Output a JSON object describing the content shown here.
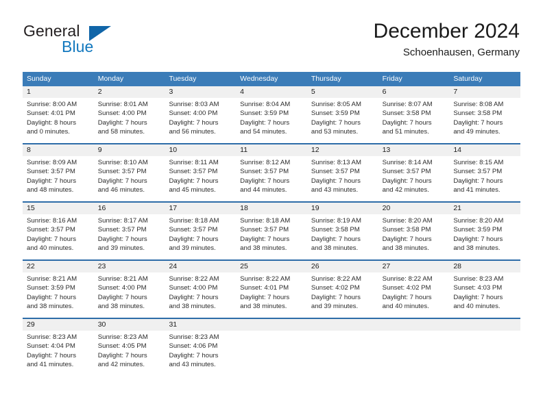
{
  "brand": {
    "name_part1": "General",
    "name_part2": "Blue",
    "accent_color": "#1065a8",
    "text_color": "#231f20"
  },
  "header": {
    "title": "December 2024",
    "location": "Schoenhausen, Germany"
  },
  "calendar": {
    "header_bg": "#3b7cb8",
    "row_border_color": "#2d6ca8",
    "daynum_bg": "#f0f0f0",
    "weekdays": [
      "Sunday",
      "Monday",
      "Tuesday",
      "Wednesday",
      "Thursday",
      "Friday",
      "Saturday"
    ],
    "weeks": [
      [
        {
          "day": "1",
          "lines": [
            "Sunrise: 8:00 AM",
            "Sunset: 4:01 PM",
            "Daylight: 8 hours",
            "and 0 minutes."
          ]
        },
        {
          "day": "2",
          "lines": [
            "Sunrise: 8:01 AM",
            "Sunset: 4:00 PM",
            "Daylight: 7 hours",
            "and 58 minutes."
          ]
        },
        {
          "day": "3",
          "lines": [
            "Sunrise: 8:03 AM",
            "Sunset: 4:00 PM",
            "Daylight: 7 hours",
            "and 56 minutes."
          ]
        },
        {
          "day": "4",
          "lines": [
            "Sunrise: 8:04 AM",
            "Sunset: 3:59 PM",
            "Daylight: 7 hours",
            "and 54 minutes."
          ]
        },
        {
          "day": "5",
          "lines": [
            "Sunrise: 8:05 AM",
            "Sunset: 3:59 PM",
            "Daylight: 7 hours",
            "and 53 minutes."
          ]
        },
        {
          "day": "6",
          "lines": [
            "Sunrise: 8:07 AM",
            "Sunset: 3:58 PM",
            "Daylight: 7 hours",
            "and 51 minutes."
          ]
        },
        {
          "day": "7",
          "lines": [
            "Sunrise: 8:08 AM",
            "Sunset: 3:58 PM",
            "Daylight: 7 hours",
            "and 49 minutes."
          ]
        }
      ],
      [
        {
          "day": "8",
          "lines": [
            "Sunrise: 8:09 AM",
            "Sunset: 3:57 PM",
            "Daylight: 7 hours",
            "and 48 minutes."
          ]
        },
        {
          "day": "9",
          "lines": [
            "Sunrise: 8:10 AM",
            "Sunset: 3:57 PM",
            "Daylight: 7 hours",
            "and 46 minutes."
          ]
        },
        {
          "day": "10",
          "lines": [
            "Sunrise: 8:11 AM",
            "Sunset: 3:57 PM",
            "Daylight: 7 hours",
            "and 45 minutes."
          ]
        },
        {
          "day": "11",
          "lines": [
            "Sunrise: 8:12 AM",
            "Sunset: 3:57 PM",
            "Daylight: 7 hours",
            "and 44 minutes."
          ]
        },
        {
          "day": "12",
          "lines": [
            "Sunrise: 8:13 AM",
            "Sunset: 3:57 PM",
            "Daylight: 7 hours",
            "and 43 minutes."
          ]
        },
        {
          "day": "13",
          "lines": [
            "Sunrise: 8:14 AM",
            "Sunset: 3:57 PM",
            "Daylight: 7 hours",
            "and 42 minutes."
          ]
        },
        {
          "day": "14",
          "lines": [
            "Sunrise: 8:15 AM",
            "Sunset: 3:57 PM",
            "Daylight: 7 hours",
            "and 41 minutes."
          ]
        }
      ],
      [
        {
          "day": "15",
          "lines": [
            "Sunrise: 8:16 AM",
            "Sunset: 3:57 PM",
            "Daylight: 7 hours",
            "and 40 minutes."
          ]
        },
        {
          "day": "16",
          "lines": [
            "Sunrise: 8:17 AM",
            "Sunset: 3:57 PM",
            "Daylight: 7 hours",
            "and 39 minutes."
          ]
        },
        {
          "day": "17",
          "lines": [
            "Sunrise: 8:18 AM",
            "Sunset: 3:57 PM",
            "Daylight: 7 hours",
            "and 39 minutes."
          ]
        },
        {
          "day": "18",
          "lines": [
            "Sunrise: 8:18 AM",
            "Sunset: 3:57 PM",
            "Daylight: 7 hours",
            "and 38 minutes."
          ]
        },
        {
          "day": "19",
          "lines": [
            "Sunrise: 8:19 AM",
            "Sunset: 3:58 PM",
            "Daylight: 7 hours",
            "and 38 minutes."
          ]
        },
        {
          "day": "20",
          "lines": [
            "Sunrise: 8:20 AM",
            "Sunset: 3:58 PM",
            "Daylight: 7 hours",
            "and 38 minutes."
          ]
        },
        {
          "day": "21",
          "lines": [
            "Sunrise: 8:20 AM",
            "Sunset: 3:59 PM",
            "Daylight: 7 hours",
            "and 38 minutes."
          ]
        }
      ],
      [
        {
          "day": "22",
          "lines": [
            "Sunrise: 8:21 AM",
            "Sunset: 3:59 PM",
            "Daylight: 7 hours",
            "and 38 minutes."
          ]
        },
        {
          "day": "23",
          "lines": [
            "Sunrise: 8:21 AM",
            "Sunset: 4:00 PM",
            "Daylight: 7 hours",
            "and 38 minutes."
          ]
        },
        {
          "day": "24",
          "lines": [
            "Sunrise: 8:22 AM",
            "Sunset: 4:00 PM",
            "Daylight: 7 hours",
            "and 38 minutes."
          ]
        },
        {
          "day": "25",
          "lines": [
            "Sunrise: 8:22 AM",
            "Sunset: 4:01 PM",
            "Daylight: 7 hours",
            "and 38 minutes."
          ]
        },
        {
          "day": "26",
          "lines": [
            "Sunrise: 8:22 AM",
            "Sunset: 4:02 PM",
            "Daylight: 7 hours",
            "and 39 minutes."
          ]
        },
        {
          "day": "27",
          "lines": [
            "Sunrise: 8:22 AM",
            "Sunset: 4:02 PM",
            "Daylight: 7 hours",
            "and 40 minutes."
          ]
        },
        {
          "day": "28",
          "lines": [
            "Sunrise: 8:23 AM",
            "Sunset: 4:03 PM",
            "Daylight: 7 hours",
            "and 40 minutes."
          ]
        }
      ],
      [
        {
          "day": "29",
          "lines": [
            "Sunrise: 8:23 AM",
            "Sunset: 4:04 PM",
            "Daylight: 7 hours",
            "and 41 minutes."
          ]
        },
        {
          "day": "30",
          "lines": [
            "Sunrise: 8:23 AM",
            "Sunset: 4:05 PM",
            "Daylight: 7 hours",
            "and 42 minutes."
          ]
        },
        {
          "day": "31",
          "lines": [
            "Sunrise: 8:23 AM",
            "Sunset: 4:06 PM",
            "Daylight: 7 hours",
            "and 43 minutes."
          ]
        },
        {
          "day": "",
          "lines": []
        },
        {
          "day": "",
          "lines": []
        },
        {
          "day": "",
          "lines": []
        },
        {
          "day": "",
          "lines": []
        }
      ]
    ]
  }
}
